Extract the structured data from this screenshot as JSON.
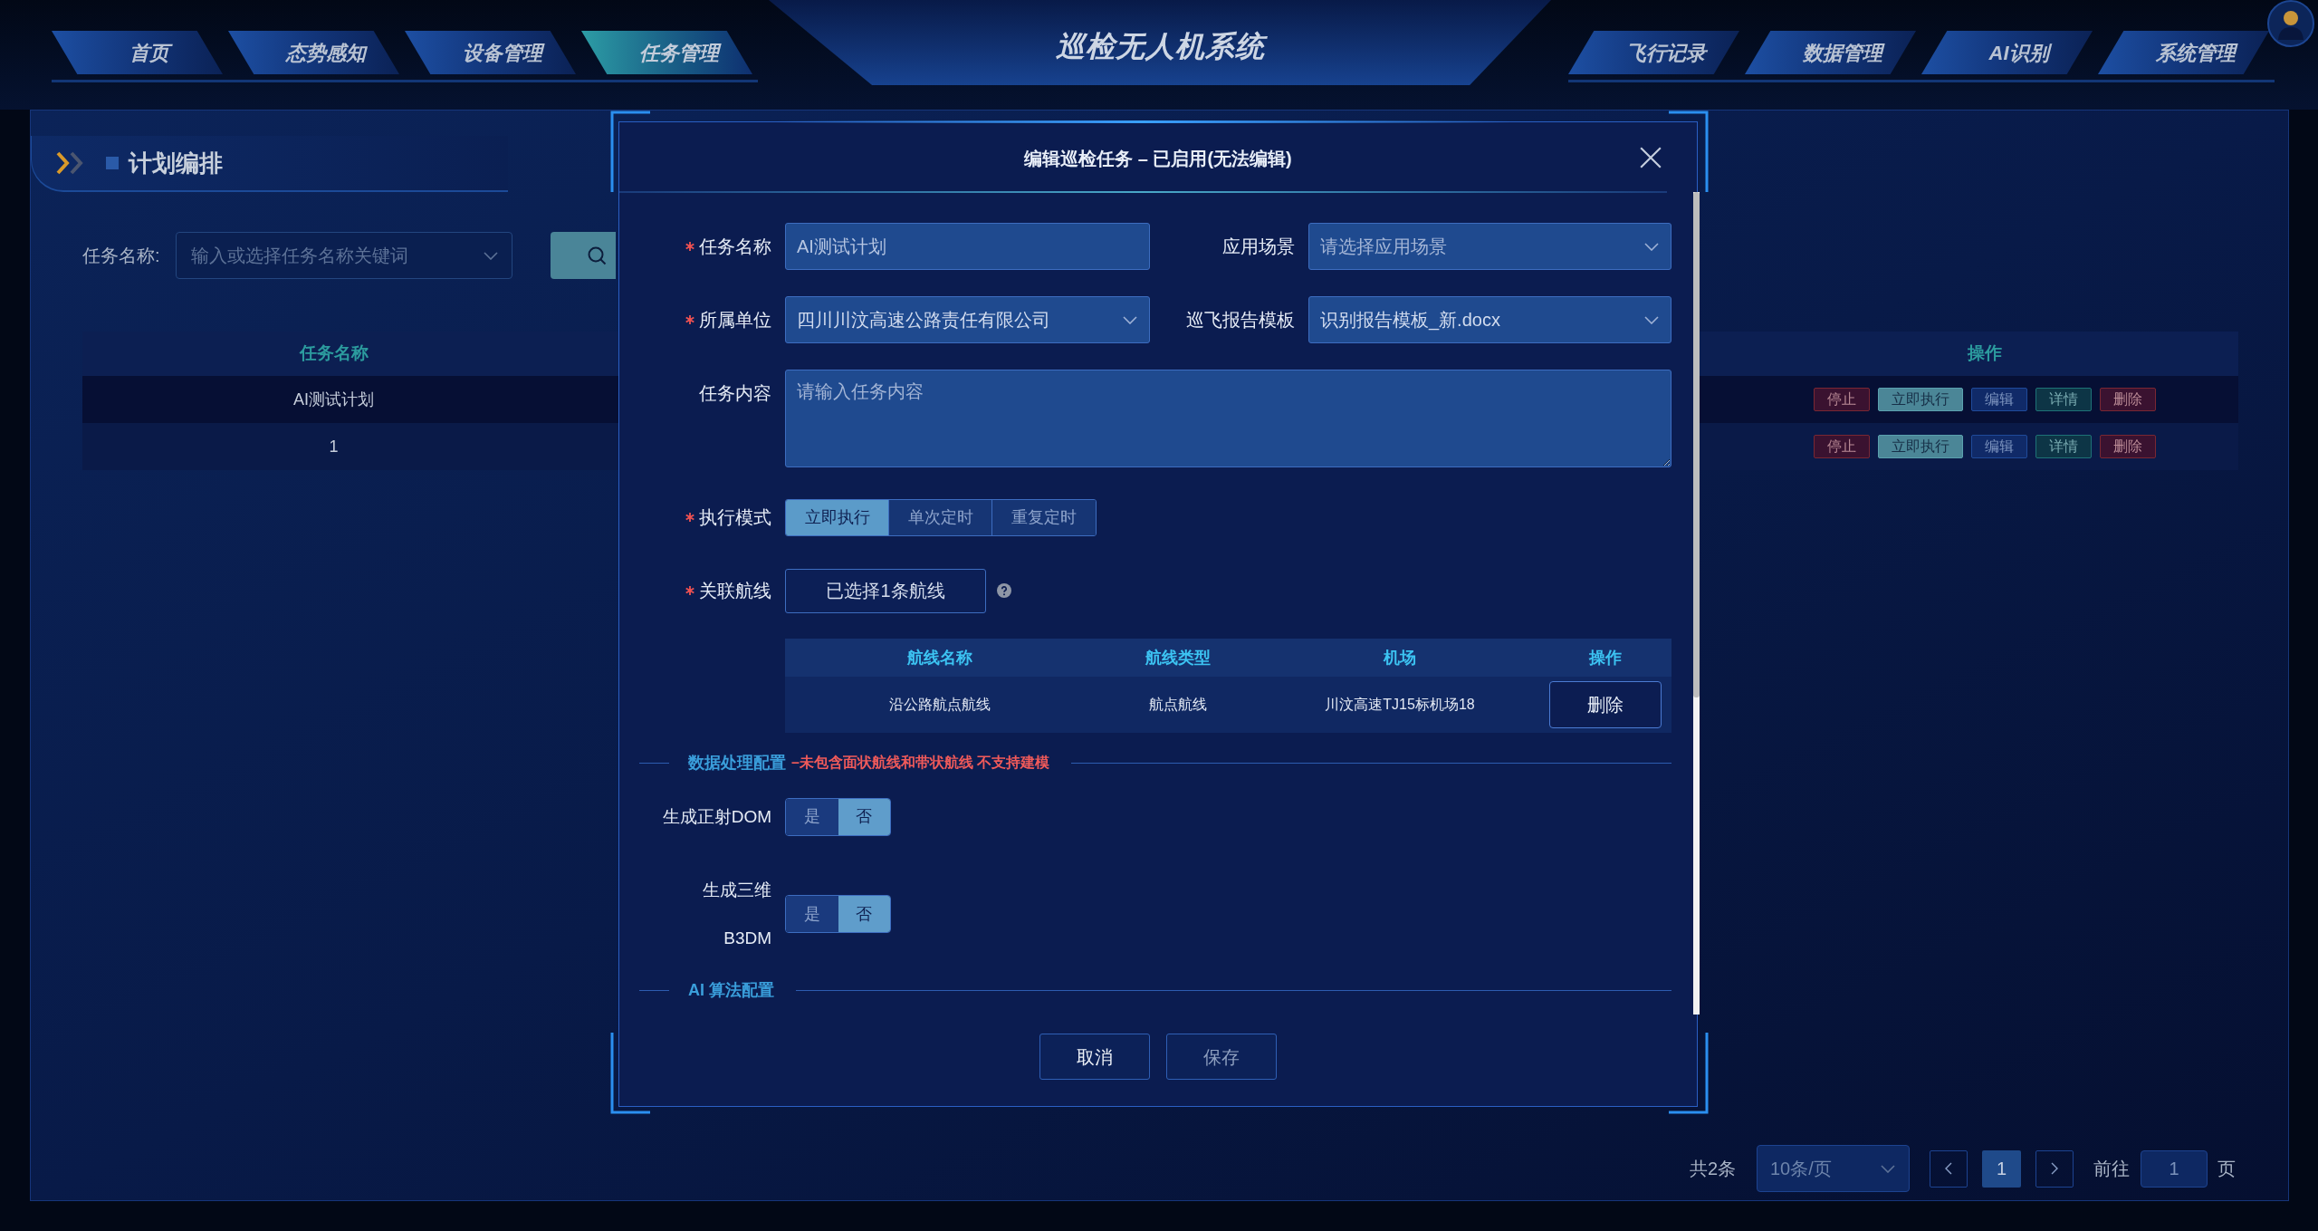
{
  "nav": {
    "title": "巡检无人机系统",
    "left_tabs": [
      {
        "label": "首页",
        "selected": false
      },
      {
        "label": "态势感知",
        "selected": false
      },
      {
        "label": "设备管理",
        "selected": false
      },
      {
        "label": "任务管理",
        "selected": true
      }
    ],
    "right_tabs": [
      {
        "label": "飞行记录",
        "selected": false
      },
      {
        "label": "数据管理",
        "selected": false
      },
      {
        "label": "AI识别",
        "selected": false
      },
      {
        "label": "系统管理",
        "selected": false
      }
    ]
  },
  "page": {
    "title": "计划编排",
    "search": {
      "label": "任务名称:",
      "placeholder": "输入或选择任务名称关键词"
    },
    "table": {
      "columns": [
        "任务名称",
        "操作"
      ],
      "rows": [
        {
          "cells": [
            "AI测试计划"
          ],
          "actions": [
            {
              "label": "停止",
              "kind": "danger"
            },
            {
              "label": "立即执行",
              "kind": "primary"
            },
            {
              "label": "编辑",
              "kind": "info"
            },
            {
              "label": "详情",
              "kind": "success"
            },
            {
              "label": "删除",
              "kind": "danger"
            }
          ]
        },
        {
          "cells": [
            "1"
          ],
          "actions": [
            {
              "label": "停止",
              "kind": "danger"
            },
            {
              "label": "立即执行",
              "kind": "primary"
            },
            {
              "label": "编辑",
              "kind": "info"
            },
            {
              "label": "详情",
              "kind": "success"
            },
            {
              "label": "删除",
              "kind": "danger"
            }
          ]
        }
      ]
    },
    "pagination": {
      "total": "共2条",
      "page_size": "10条/页",
      "pages": [
        {
          "label": "1",
          "selected": true
        }
      ],
      "goto": {
        "label": "前往",
        "value": "1",
        "suffix": "页"
      }
    }
  },
  "dialog": {
    "title": "编辑巡检任务 – 已启用(无法编辑)",
    "fields": [
      {
        "kind": "input",
        "label": "任务名称",
        "required": true,
        "value": "AI测试计划"
      },
      {
        "kind": "select",
        "label": "应用场景",
        "required": false,
        "placeholder": "请选择应用场景"
      },
      {
        "kind": "select",
        "label": "所属单位",
        "required": true,
        "value": "四川川汶高速公路责任有限公司"
      },
      {
        "kind": "select",
        "label": "巡飞报告模板",
        "required": false,
        "value": "识别报告模板_新.docx"
      },
      {
        "kind": "textarea",
        "label": "任务内容",
        "required": false,
        "placeholder": "请输入任务内容"
      },
      {
        "kind": "segmented",
        "label": "执行模式",
        "required": true,
        "options": [
          {
            "label": "立即执行",
            "selected": true
          },
          {
            "label": "单次定时",
            "selected": false
          },
          {
            "label": "重复定时",
            "selected": false
          }
        ]
      },
      {
        "kind": "route_picker",
        "label": "关联航线",
        "required": true,
        "button": "已选择1条航线"
      }
    ],
    "routes_table": {
      "columns": [
        "航线名称",
        "航线类型",
        "机场",
        "操作"
      ],
      "rows": [
        {
          "cells": [
            "沿公路航点航线",
            "航点航线",
            "川汶高速TJ15标机场18"
          ],
          "action": "删除"
        }
      ]
    },
    "sections": [
      {
        "title": "数据处理配置",
        "note": "–未包含面状航线和带状航线 不支持建模",
        "options": [
          {
            "label": "生成正射DOM",
            "choices": [
              {
                "label": "是",
                "selected": false
              },
              {
                "label": "否",
                "selected": true
              }
            ]
          },
          {
            "label": "生成三维 B3DM",
            "choices": [
              {
                "label": "是",
                "selected": false
              },
              {
                "label": "否",
                "selected": true
              }
            ]
          }
        ]
      },
      {
        "title": "AI 算法配置"
      }
    ],
    "buttons": [
      {
        "label": "取消",
        "disabled": false
      },
      {
        "label": "保存",
        "disabled": true
      }
    ]
  }
}
